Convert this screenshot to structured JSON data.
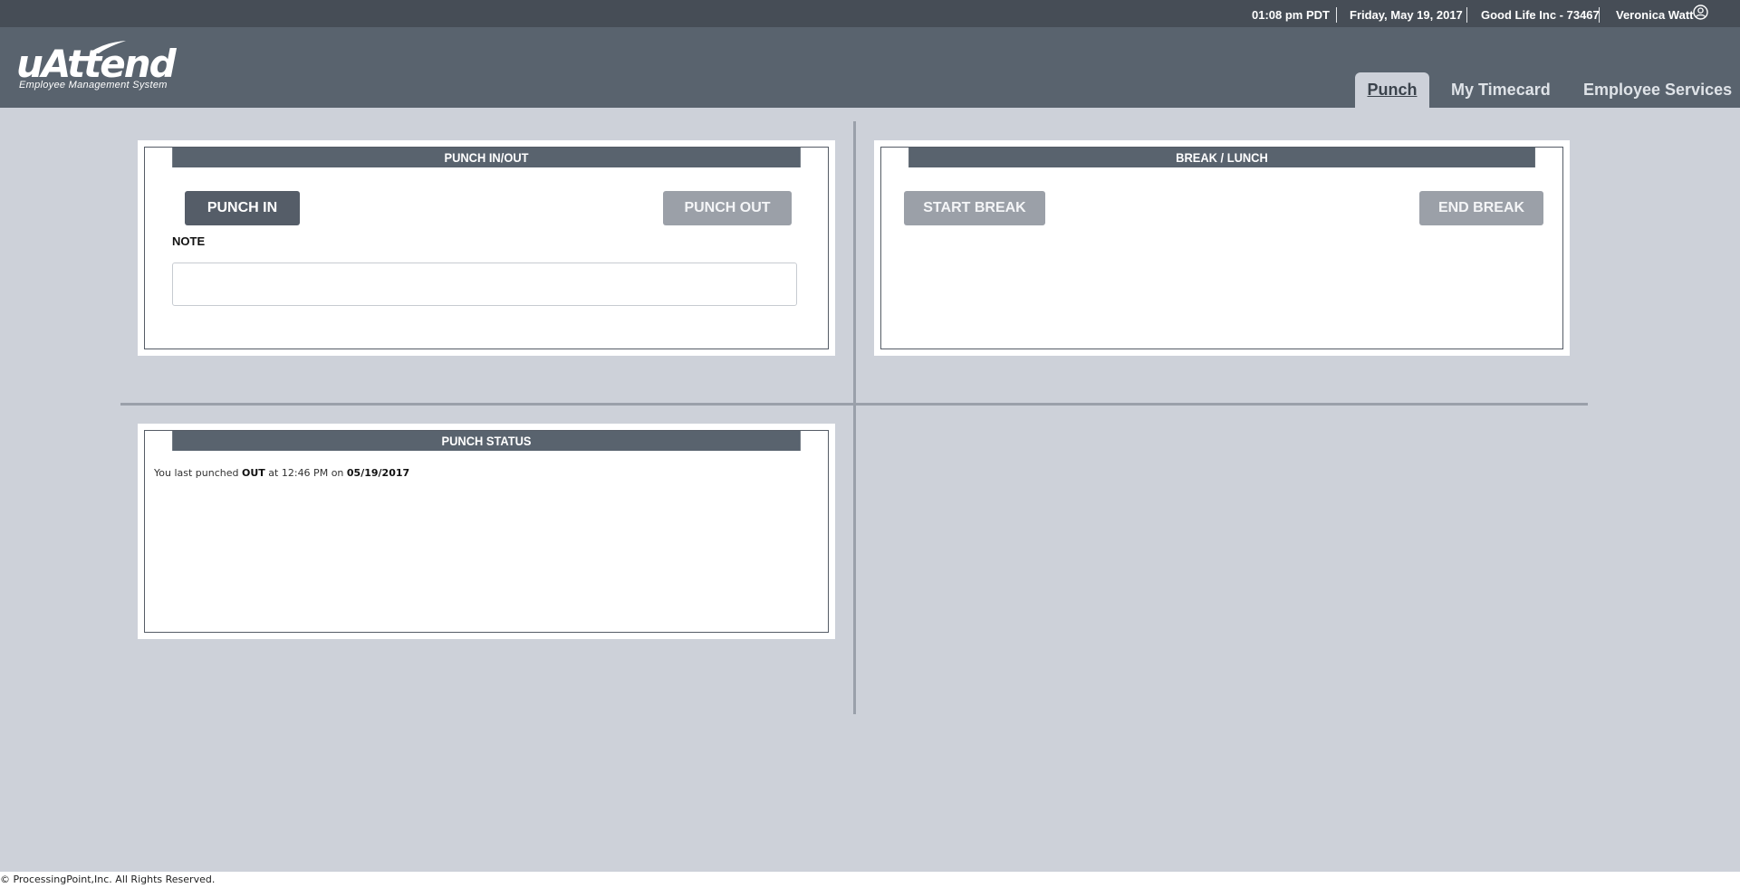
{
  "topbar": {
    "time": "01:08 pm PDT",
    "date": "Friday, May 19, 2017",
    "company": "Good Life Inc - 73467",
    "user": "Veronica Watt",
    "user_icon": "user-circle-icon"
  },
  "logo": {
    "name": "uAttend",
    "tagline": "Employee Management System"
  },
  "nav": {
    "tabs": [
      {
        "label": "Punch",
        "active": true
      },
      {
        "label": "My Timecard",
        "active": false
      },
      {
        "label": "Employee Services",
        "active": false
      }
    ]
  },
  "punch_panel": {
    "title": "PUNCH IN/OUT",
    "punch_in_label": "PUNCH IN",
    "punch_out_label": "PUNCH OUT",
    "note_label": "NOTE",
    "note_value": "",
    "note_placeholder": ""
  },
  "break_panel": {
    "title": "BREAK / LUNCH",
    "start_label": "START BREAK",
    "end_label": "END BREAK"
  },
  "status_panel": {
    "title": "PUNCH STATUS",
    "prefix": "You last punched",
    "direction": "OUT",
    "at_word": "at",
    "time": "12:46 PM",
    "on_word": "on",
    "date": "05/19/2017"
  },
  "footer": {
    "copyright": "© ProcessingPoint,Inc. All Rights Reserved."
  },
  "colors": {
    "topbar": "#464d56",
    "header": "#59636e",
    "background": "#cdd1d9",
    "button_active": "#555d68",
    "button_disabled": "#9ba0a8"
  }
}
